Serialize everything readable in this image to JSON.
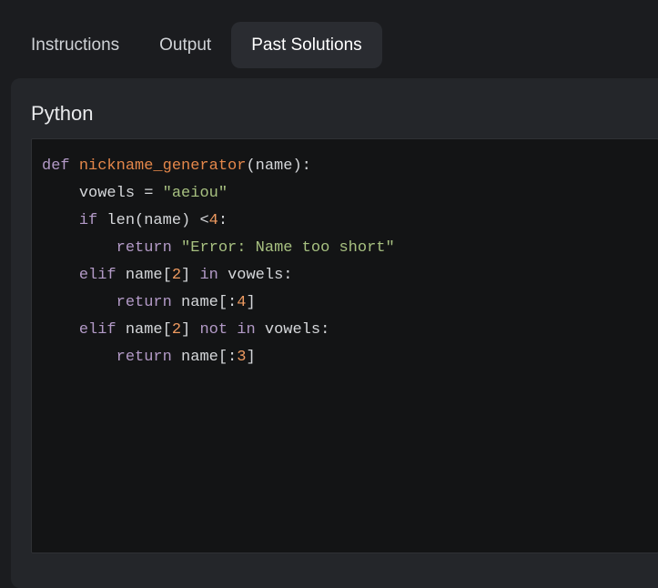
{
  "tabs": [
    {
      "label": "Instructions",
      "active": false
    },
    {
      "label": "Output",
      "active": false
    },
    {
      "label": "Past Solutions",
      "active": true
    }
  ],
  "panel": {
    "language": "Python",
    "code_lines": [
      "def nickname_generator(name):",
      "    vowels = \"aeiou\"",
      "    if len(name) <4:",
      "        return \"Error: Name too short\"",
      "    elif name[2] in vowels:",
      "        return name[:4]",
      "    elif name[2] not in vowels:",
      "        return name[:3]"
    ]
  },
  "colors": {
    "background": "#1b1c1f",
    "panel": "#24262a",
    "code_bg": "#131415",
    "keyword": "#b39ac7",
    "function": "#e4874a",
    "string": "#a7c080",
    "number": "#ee9a60"
  }
}
